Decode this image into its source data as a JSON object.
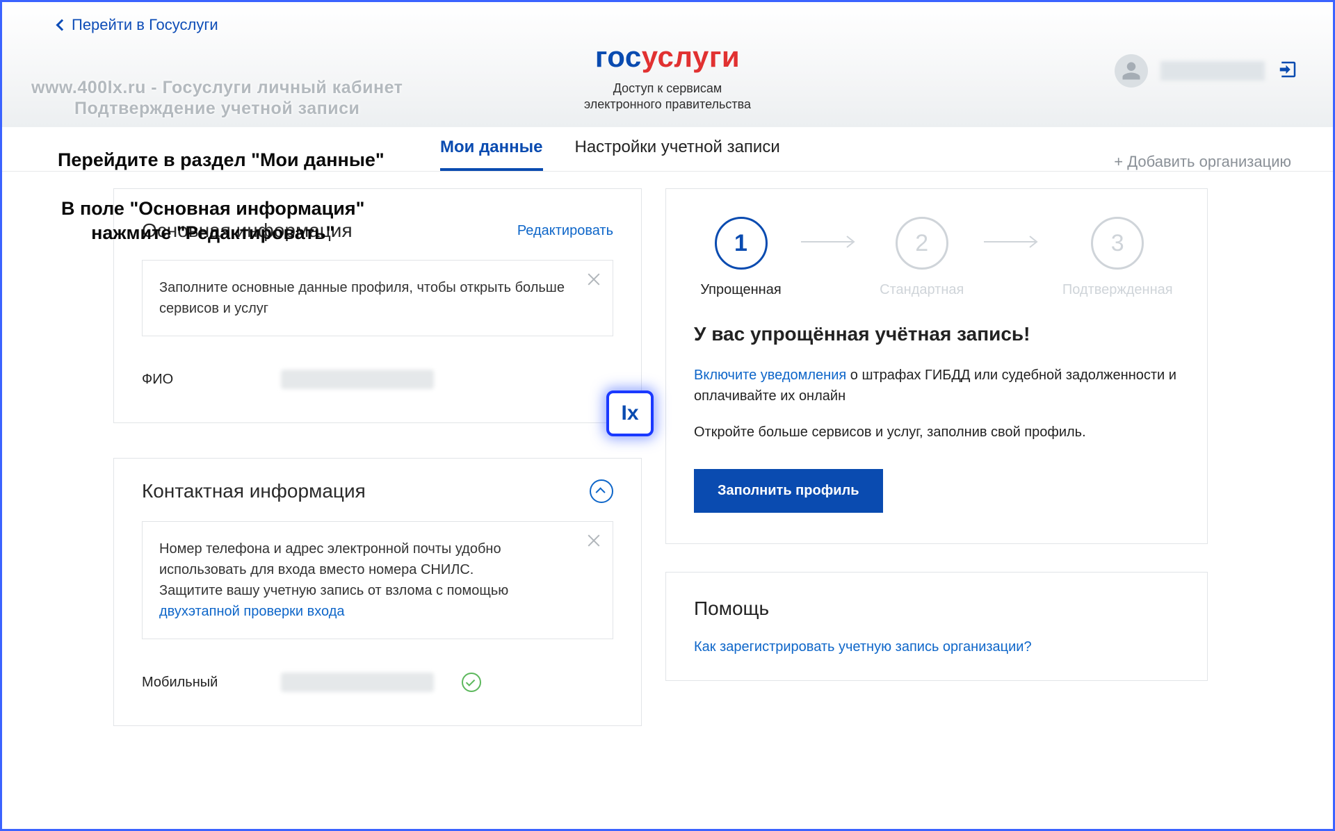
{
  "header": {
    "back_link": "Перейти в Госуслуги",
    "watermark_line1": "www.400lx.ru - Госуслуги личный кабинет",
    "watermark_line2": "Подтверждение учетной записи",
    "brand_gos": "гос",
    "brand_uslugi": "услуги",
    "brand_sub1": "Доступ к сервисам",
    "brand_sub2": "электронного правительства"
  },
  "tabs": {
    "heading": "Перейдите в раздел \"Мои данные\"",
    "items": [
      {
        "label": "Мои данные"
      },
      {
        "label": "Настройки учетной записи"
      }
    ],
    "add_org": "+ Добавить организацию"
  },
  "hint": {
    "line1": "В поле \"Основная информация\"",
    "line2": "нажмите \"Редактировать\""
  },
  "basic_info": {
    "title": "Основная информация",
    "edit": "Редактировать",
    "notice": "Заполните основные данные профиля, чтобы открыть больше сервисов и услуг",
    "fio_label": "ФИО"
  },
  "ix_badge": "Ix",
  "contact_info": {
    "title": "Контактная информация",
    "notice_line1": "Номер телефона и адрес электронной почты удобно использовать для входа вместо номера СНИЛС.",
    "notice_line2": "Защитите вашу учетную запись от взлома с помощью ",
    "notice_link": "двухэтапной проверки входа",
    "mobile_label": "Мобильный"
  },
  "steps": {
    "items": [
      {
        "num": "1",
        "label": "Упрощенная"
      },
      {
        "num": "2",
        "label": "Стандартная"
      },
      {
        "num": "3",
        "label": "Подтвержденная"
      }
    ]
  },
  "status": {
    "title": "У вас упрощённая учётная запись!",
    "link": "Включите уведомления",
    "text1_rest": " о штрафах ГИБДД или судебной задолженности и оплачивайте их онлайн",
    "text2": "Откройте больше сервисов и услуг, заполнив свой профиль.",
    "button": "Заполнить профиль"
  },
  "help": {
    "title": "Помощь",
    "q1": "Как зарегистрировать учетную запись организации?"
  }
}
